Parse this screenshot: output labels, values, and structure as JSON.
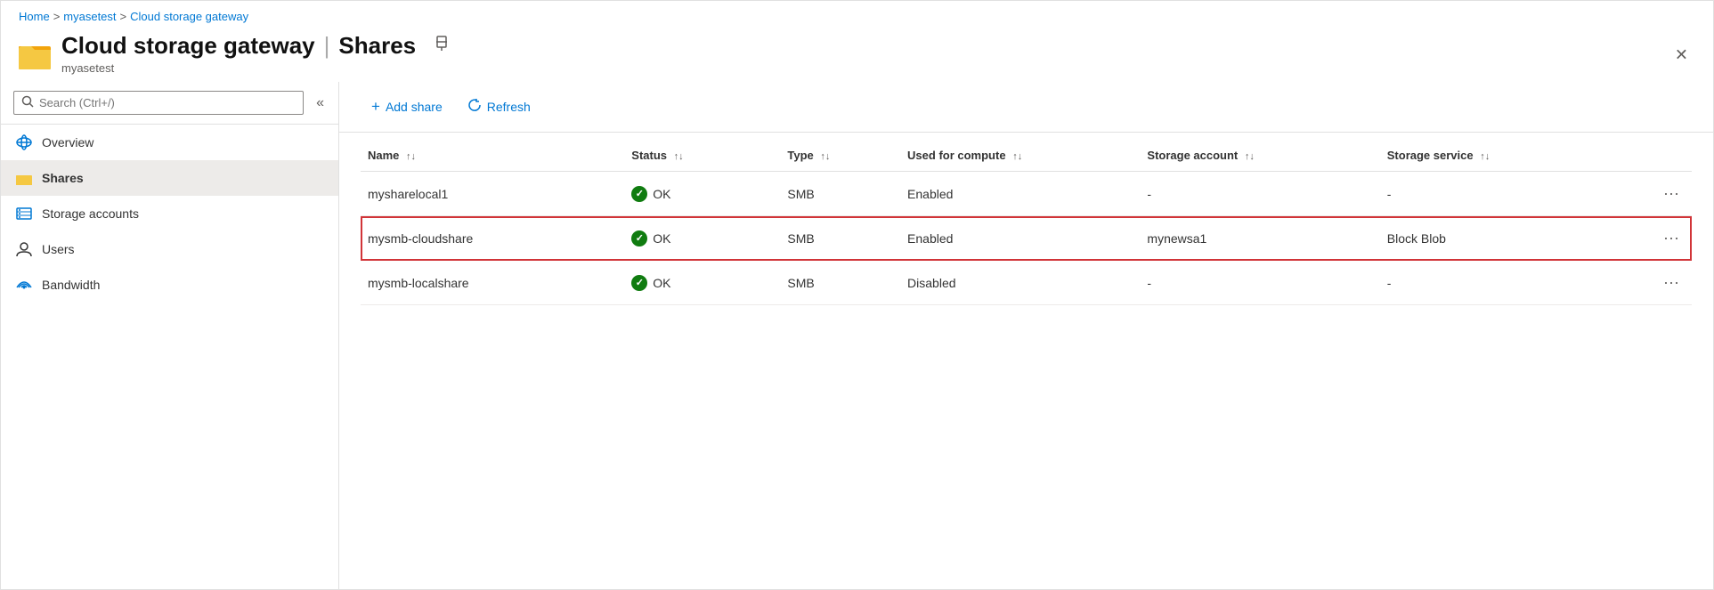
{
  "breadcrumb": {
    "home": "Home",
    "sep1": ">",
    "myasetest": "myasetest",
    "sep2": ">",
    "current": "Cloud storage gateway"
  },
  "header": {
    "title": "Cloud storage gateway",
    "divider": "|",
    "subtitle_page": "Shares",
    "subtitle_resource": "myasetest",
    "pin_label": "pin",
    "close_label": "✕"
  },
  "search": {
    "placeholder": "Search (Ctrl+/)"
  },
  "sidebar": {
    "collapse_label": "«",
    "items": [
      {
        "id": "overview",
        "label": "Overview",
        "icon": "cloud"
      },
      {
        "id": "shares",
        "label": "Shares",
        "icon": "folder",
        "active": true
      },
      {
        "id": "storage-accounts",
        "label": "Storage accounts",
        "icon": "storage"
      },
      {
        "id": "users",
        "label": "Users",
        "icon": "user"
      },
      {
        "id": "bandwidth",
        "label": "Bandwidth",
        "icon": "wifi"
      }
    ]
  },
  "toolbar": {
    "add_share_label": "Add share",
    "refresh_label": "Refresh"
  },
  "table": {
    "columns": [
      {
        "id": "name",
        "label": "Name"
      },
      {
        "id": "status",
        "label": "Status"
      },
      {
        "id": "type",
        "label": "Type"
      },
      {
        "id": "compute",
        "label": "Used for compute"
      },
      {
        "id": "storage_account",
        "label": "Storage account"
      },
      {
        "id": "storage_service",
        "label": "Storage service"
      },
      {
        "id": "actions",
        "label": ""
      }
    ],
    "rows": [
      {
        "id": "row1",
        "name": "mysharelocal1",
        "status": "OK",
        "type": "SMB",
        "compute": "Enabled",
        "storage_account": "-",
        "storage_service": "-",
        "highlighted": false
      },
      {
        "id": "row2",
        "name": "mysmb-cloudshare",
        "status": "OK",
        "type": "SMB",
        "compute": "Enabled",
        "storage_account": "mynewsa1",
        "storage_service": "Block Blob",
        "highlighted": true
      },
      {
        "id": "row3",
        "name": "mysmb-localshare",
        "status": "OK",
        "type": "SMB",
        "compute": "Disabled",
        "storage_account": "-",
        "storage_service": "-",
        "highlighted": false
      }
    ]
  },
  "colors": {
    "accent": "#0078d4",
    "highlight_border": "#d13438",
    "ok_green": "#107c10",
    "folder_yellow": "#f2a40c"
  }
}
